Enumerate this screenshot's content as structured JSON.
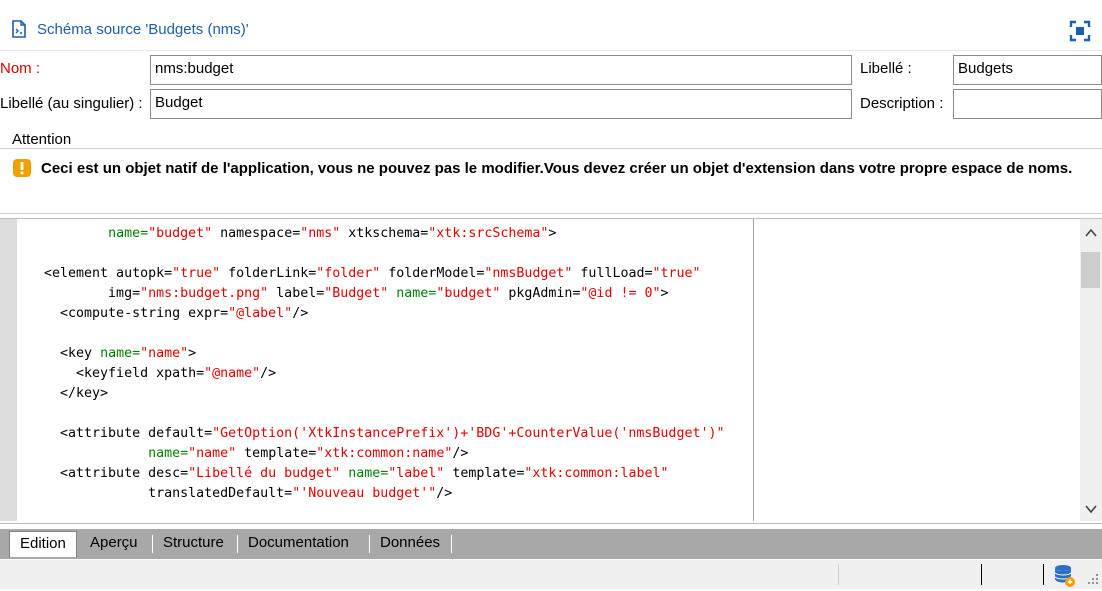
{
  "window": {
    "title": "Schéma source 'Budgets (nms)'",
    "icons": {
      "document": "schema-document-icon",
      "maximize": "maximize-icon"
    }
  },
  "form": {
    "name_label": "Nom :",
    "name_value": "nms:budget",
    "label_label": "Libellé :",
    "label_value": "Budgets",
    "singular_label": "Libellé (au singulier) :",
    "singular_value": "Budget",
    "description_label": "Description :",
    "description_value": ""
  },
  "attention": {
    "title": "Attention",
    "message": "Ceci est un objet natif de l'application, vous ne pouvez pas le modifier.Vous devez créer un objet d'extension dans votre propre espace de noms.",
    "icon": "warning-icon"
  },
  "editor": {
    "lines": [
      [
        [
          "",
          "          "
        ],
        [
          "a",
          "name="
        ],
        [
          "v",
          "\"budget\""
        ],
        [
          "n",
          " namespace="
        ],
        [
          "v",
          "\"nms\""
        ],
        [
          "n",
          " xtkschema="
        ],
        [
          "v",
          "\"xtk:srcSchema\""
        ],
        [
          "n",
          ">"
        ]
      ],
      [],
      [
        [
          "n",
          "  <element autopk="
        ],
        [
          "v",
          "\"true\""
        ],
        [
          "n",
          " folderLink="
        ],
        [
          "v",
          "\"folder\""
        ],
        [
          "n",
          " folderModel="
        ],
        [
          "v",
          "\"nmsBudget\""
        ],
        [
          "n",
          " fullLoad="
        ],
        [
          "v",
          "\"true\""
        ]
      ],
      [
        [
          "n",
          "          img="
        ],
        [
          "v",
          "\"nms:budget.png\""
        ],
        [
          "n",
          " label="
        ],
        [
          "v",
          "\"Budget\""
        ],
        [
          "n",
          " "
        ],
        [
          "a",
          "name="
        ],
        [
          "v",
          "\"budget\""
        ],
        [
          "n",
          " pkgAdmin="
        ],
        [
          "v",
          "\"@id != 0\""
        ],
        [
          "n",
          ">"
        ]
      ],
      [
        [
          "n",
          "    <compute-string expr="
        ],
        [
          "v",
          "\"@label\""
        ],
        [
          "n",
          "/>"
        ]
      ],
      [],
      [
        [
          "n",
          "    <key "
        ],
        [
          "a",
          "name="
        ],
        [
          "v",
          "\"name\""
        ],
        [
          "n",
          ">"
        ]
      ],
      [
        [
          "n",
          "      <keyfield xpath="
        ],
        [
          "v",
          "\"@name\""
        ],
        [
          "n",
          "/>"
        ]
      ],
      [
        [
          "n",
          "    </key>"
        ]
      ],
      [],
      [
        [
          "n",
          "    <attribute default="
        ],
        [
          "v",
          "\"GetOption('XtkInstancePrefix')+'BDG'+CounterValue('nmsBudget')\""
        ]
      ],
      [
        [
          "n",
          "               "
        ],
        [
          "a",
          "name="
        ],
        [
          "v",
          "\"name\""
        ],
        [
          "n",
          " template="
        ],
        [
          "v",
          "\"xtk:common:name\""
        ],
        [
          "n",
          "/>"
        ]
      ],
      [
        [
          "n",
          "    <attribute desc="
        ],
        [
          "v",
          "\"Libellé du budget\""
        ],
        [
          "n",
          " "
        ],
        [
          "a",
          "name="
        ],
        [
          "v",
          "\"label\""
        ],
        [
          "n",
          " template="
        ],
        [
          "v",
          "\"xtk:common:label\""
        ]
      ],
      [
        [
          "n",
          "               translatedDefault="
        ],
        [
          "v",
          "\"'Nouveau budget'\""
        ],
        [
          "n",
          "/>"
        ]
      ]
    ]
  },
  "tabs": [
    "Edition",
    "Aperçu",
    "Structure",
    "Documentation",
    "Données"
  ],
  "active_tab": "Edition",
  "colors": {
    "title_blue": "#1d5fa8",
    "required_red": "#d80000",
    "xml_attr_green": "#008000",
    "xml_value_red": "#e60000",
    "warning_orange": "#f0a000"
  }
}
